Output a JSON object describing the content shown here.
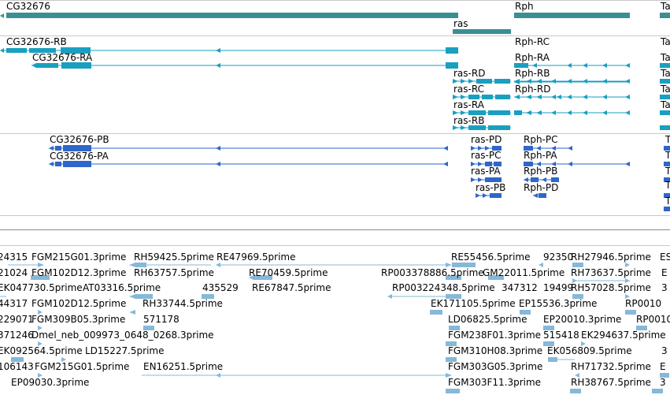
{
  "colors": {
    "gene": "#3a8f93",
    "transcript": "#1a9fc0",
    "protein": "#2e67c9",
    "est": "#86b8d8",
    "separator": "#c8c8c8"
  },
  "genes": [
    {
      "name": "CG32676",
      "label": "CG32676"
    },
    {
      "name": "ras",
      "label": "ras"
    },
    {
      "name": "Rph",
      "label": "Rph"
    },
    {
      "name": "Ta",
      "label": "Ta"
    }
  ],
  "transcripts": [
    {
      "label": "CG32676-RB"
    },
    {
      "label": "CG32676-RA"
    },
    {
      "label": "Rph-RC"
    },
    {
      "label": "Rph-RA"
    },
    {
      "label": "Rph-RB"
    },
    {
      "label": "Rph-RD"
    },
    {
      "label": "ras-RD"
    },
    {
      "label": "ras-RC"
    },
    {
      "label": "ras-RA"
    },
    {
      "label": "ras-RB"
    },
    {
      "label": "Ta"
    },
    {
      "label": "Ta"
    },
    {
      "label": "Ta"
    },
    {
      "label": "Ta"
    },
    {
      "label": "Ta"
    }
  ],
  "proteins": [
    {
      "label": "CG32676-PB"
    },
    {
      "label": "CG32676-PA"
    },
    {
      "label": "ras-PD"
    },
    {
      "label": "ras-PC"
    },
    {
      "label": "ras-PA"
    },
    {
      "label": "ras-PB"
    },
    {
      "label": "Rph-PC"
    },
    {
      "label": "Rph-PA"
    },
    {
      "label": "Rph-PB"
    },
    {
      "label": "Rph-PD"
    },
    {
      "label": "T"
    },
    {
      "label": "T"
    },
    {
      "label": "T"
    },
    {
      "label": "T"
    },
    {
      "label": "T"
    }
  ],
  "ests": [
    "24315",
    "FGM215G01.3prime",
    "RH59425.5prime",
    "RE47969.5prime",
    "RE55456.5prime",
    "92350",
    "RH27946.5prime",
    "ES",
    "21024",
    "FGM102D12.3prime",
    "RH63757.5prime",
    "RE70459.5prime",
    "RP003378886.5prime",
    "GM22011.5prime",
    "RH73637.5prime",
    "E",
    "EK047730.5prime",
    "AT03316.5prime",
    "435529",
    "RE67847.5prime",
    "RP003224348.5prime",
    "347312",
    "19499",
    "RH57028.5prime",
    "3",
    "44317",
    "FGM102D12.5prime",
    "RH33744.5prime",
    "EK171105.5prime",
    "EP15536.3prime",
    "RP0010",
    "229071",
    "FGM309B05.3prime",
    "571178",
    "LD06825.5prime",
    "EP20010.3prime",
    "RP0010",
    "371246",
    "Dmel_neb_009973_0648_0268.3prime",
    "FGM238F01.3prime",
    "515418",
    "EK294637.5prime",
    "EK092564.5prime",
    "LD15227.5prime",
    "FGM310H08.3prime",
    "EK056809.5prime",
    "3",
    "106143",
    "FGM215G01.5prime",
    "EN16251.5prime",
    "FGM303G05.3prime",
    "RH71732.5prime",
    "E",
    "EP09030.3prime",
    "FGM303F11.3prime",
    "RH38767.5prime",
    "3"
  ]
}
